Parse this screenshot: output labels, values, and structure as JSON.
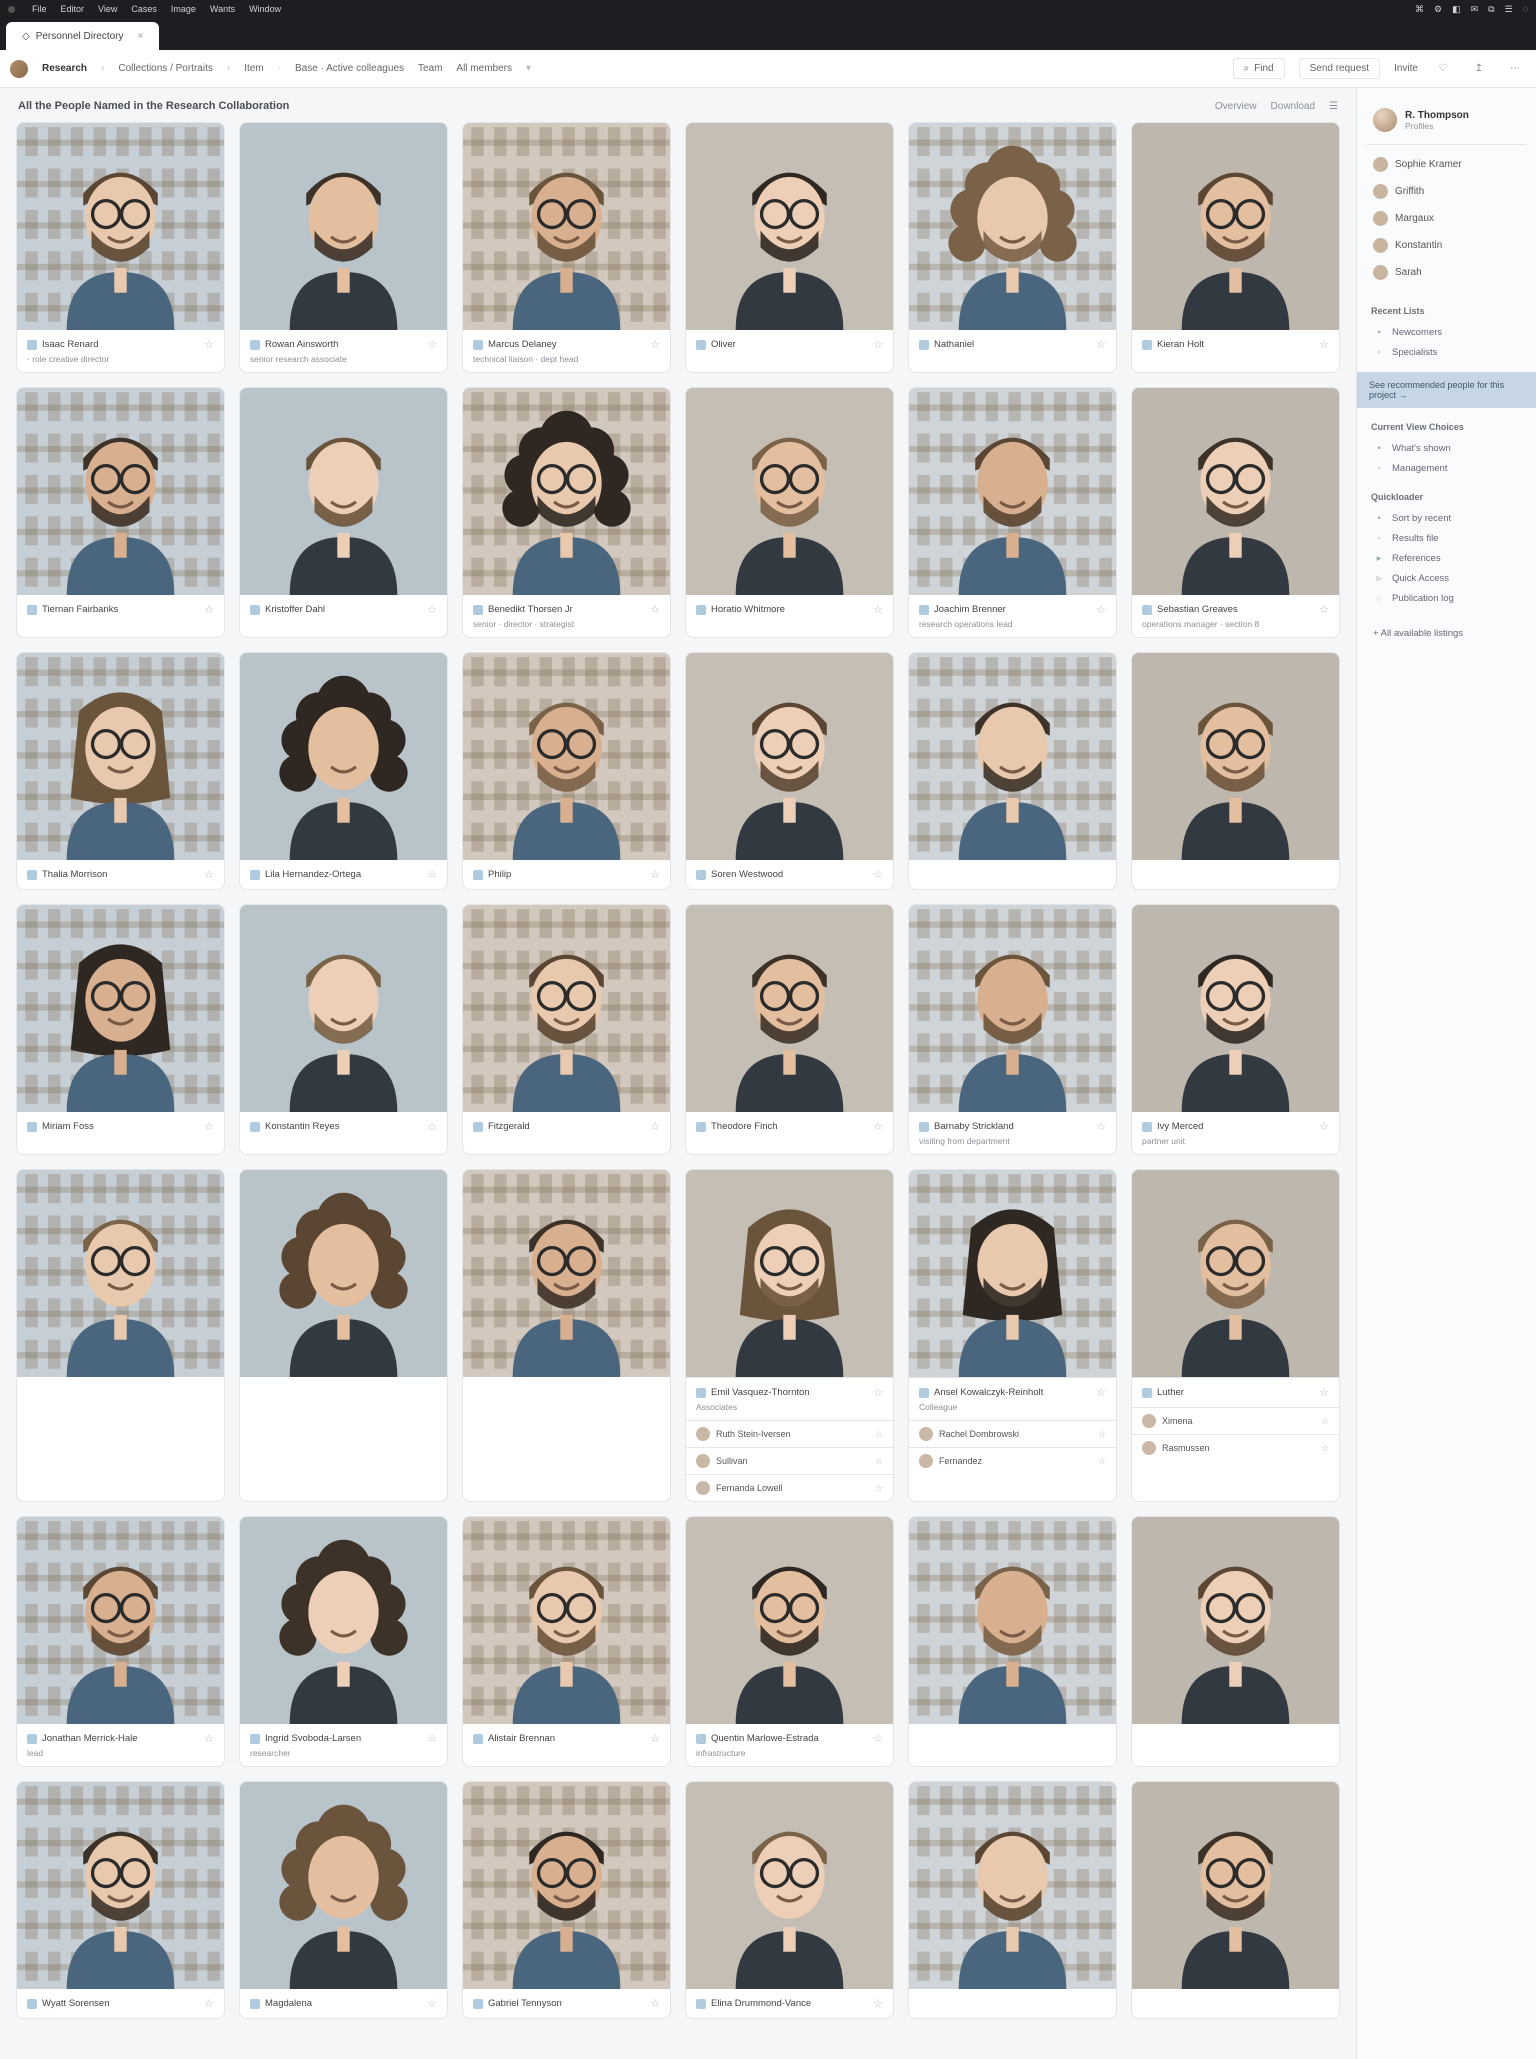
{
  "os": {
    "menu": [
      "File",
      "Editor",
      "View",
      "Cases",
      "Image",
      "Wants",
      "Window"
    ],
    "right": [
      "⌘",
      "⚙",
      "◧",
      "✉",
      "⧉",
      "☰",
      "◌"
    ]
  },
  "tabs": [
    {
      "label": "Personnel Directory",
      "active": true
    }
  ],
  "toolbar": {
    "app": "Research",
    "crumbs": [
      "Collections / Portraits",
      "Item",
      "Base · Active colleagues",
      "Team",
      "All members"
    ],
    "search_btn": "Find",
    "send_btn": "Send request",
    "invite": "Invite"
  },
  "heading": "All the People Named in the Research Collaboration",
  "head_controls": [
    "Overview",
    "Download",
    "☰"
  ],
  "sidebar": {
    "profile": {
      "name": "R. Thompson",
      "sub": "Profiles"
    },
    "people": [
      "Sophie Kramer",
      "Griffith",
      "Margaux",
      "Konstantin",
      "Sarah"
    ],
    "section1_title": "Recent Lists",
    "section1_items": [
      "Newcomers",
      "Specialists"
    ],
    "banner": "See recommended people for this project →",
    "section2_title": "Current View Choices",
    "section2_items": [
      "What's shown",
      "Management"
    ],
    "section3_title": "Quickloader",
    "section3_items": [
      "Sort by recent",
      "Results file",
      "References",
      "Quick Access",
      "Publication log"
    ]
  },
  "cards": [
    {
      "name": "Isaac Renard",
      "sub": "· role creative director",
      "v": 0
    },
    {
      "name": "Rowan Ainsworth",
      "sub": "senior research associate",
      "v": 1
    },
    {
      "name": "Marcus Delaney",
      "sub": "technical liaison · dept head",
      "v": 2
    },
    {
      "name": "Oliver",
      "sub": "",
      "v": 3
    },
    {
      "name": "Nathaniel",
      "sub": "",
      "v": 4
    },
    {
      "name": "Kieran Holt",
      "sub": "",
      "v": 5
    },
    {
      "name": "Tiernan Fairbanks",
      "sub": "",
      "v": 6
    },
    {
      "name": "Kristoffer Dahl",
      "sub": "",
      "v": 7
    },
    {
      "name": "Benedikt Thorsen Jr",
      "sub": "senior · director · strategist",
      "v": 8
    },
    {
      "name": "Horatio Whitmore",
      "sub": "",
      "v": 9
    },
    {
      "name": "Joachim Brenner",
      "sub": "research operations lead",
      "v": 10
    },
    {
      "name": "Sebastian Greaves",
      "sub": "operations manager · section 8",
      "v": 11
    },
    {
      "name": "Thalia Morrison",
      "sub": "",
      "v": 12
    },
    {
      "name": "Lila Hernandez-Ortega",
      "sub": "",
      "v": 13
    },
    {
      "name": "Philip",
      "sub": "",
      "v": 14
    },
    {
      "name": "Soren Westwood",
      "sub": "",
      "v": 15
    },
    {
      "name": "",
      "sub": "",
      "v": 16,
      "nometa": true
    },
    {
      "name": "",
      "sub": "",
      "v": 17,
      "nometa": true
    },
    {
      "name": "Miriam Foss",
      "sub": "",
      "v": 18
    },
    {
      "name": "Konstantin Reyes",
      "sub": "",
      "v": 19
    },
    {
      "name": "Fitzgerald",
      "sub": "",
      "v": 20
    },
    {
      "name": "Theodore Finch",
      "sub": "",
      "v": 21
    },
    {
      "name": "Barnaby Strickland",
      "sub": "visiting from department",
      "v": 22
    },
    {
      "name": "Ivy Merced",
      "sub": "partner unit",
      "v": 23
    },
    {
      "name": "",
      "sub": "",
      "v": 24,
      "nometa": true
    },
    {
      "name": "",
      "sub": "",
      "v": 25,
      "nometa": true
    },
    {
      "name": "",
      "sub": "",
      "v": 26,
      "nometa": true
    },
    {
      "name": "Emil Vasquez-Thornton",
      "sub": "Associates",
      "expanded": true,
      "v": 27,
      "subs": [
        {
          "n": "Ruth Stein-Iversen"
        },
        {
          "n": "Sullivan"
        },
        {
          "n": "Fernanda Lowell"
        }
      ]
    },
    {
      "name": "Ansel Kowalczyk-Reinholt",
      "sub": "Colleague",
      "expanded": true,
      "v": 28,
      "subs": [
        {
          "n": "Rachel Dombrowski"
        },
        {
          "n": "Fernandez"
        }
      ]
    },
    {
      "name": "Luther",
      "sub": "",
      "expanded": true,
      "v": 29,
      "subs": [
        {
          "n": "Ximena"
        },
        {
          "n": "Rasmussen"
        }
      ]
    },
    {
      "name": "Jonathan Merrick-Hale",
      "sub": "lead",
      "v": 30
    },
    {
      "name": "Ingrid Svoboda-Larsen",
      "sub": "researcher",
      "v": 31
    },
    {
      "name": "Alistair Brennan",
      "sub": "",
      "v": 32
    },
    {
      "name": "Quentin Marlowe-Estrada",
      "sub": "infrastructure",
      "v": 33
    },
    {
      "name": "",
      "sub": "",
      "v": 34,
      "nometa": true
    },
    {
      "name": "",
      "sub": "",
      "v": 35,
      "nometa": true
    },
    {
      "name": "Wyatt Sorensen",
      "sub": "",
      "v": 36
    },
    {
      "name": "Magdalena",
      "sub": "",
      "v": 37
    },
    {
      "name": "Gabriel Tennyson",
      "sub": "",
      "v": 38
    },
    {
      "name": "Elina Drummond-Vance",
      "sub": "",
      "v": 39
    },
    {
      "name": "",
      "sub": "",
      "v": 40,
      "nometa": true
    },
    {
      "name": "",
      "sub": "",
      "v": 41,
      "nometa": true
    }
  ],
  "footer_link": "+ All available listings"
}
